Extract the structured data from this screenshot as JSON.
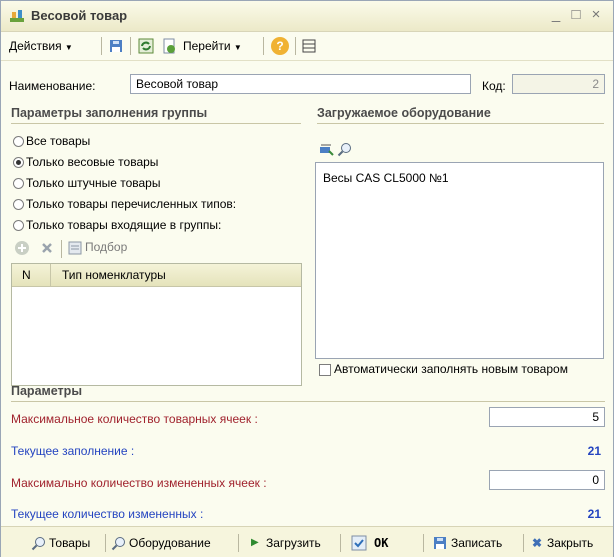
{
  "window": {
    "title": "Весовой товар",
    "minimize_glyph": "_",
    "maximize_glyph": "□",
    "close_glyph": "×"
  },
  "toolbar": {
    "actions_label": "Действия",
    "goto_label": "Перейти",
    "help_glyph": "?"
  },
  "form": {
    "name_label": "Наименование:",
    "name_value": "Весовой товар",
    "code_label": "Код:",
    "code_value": "2"
  },
  "fill_params": {
    "title": "Параметры заполнения группы",
    "options": [
      {
        "label": "Все товары",
        "selected": false
      },
      {
        "label": "Только весовые товары",
        "selected": true
      },
      {
        "label": "Только штучные товары",
        "selected": false
      },
      {
        "label": "Только товары перечисленных типов:",
        "selected": false
      },
      {
        "label": "Только товары входящие в группы:",
        "selected": false
      }
    ],
    "select_label": "Подбор",
    "table": {
      "col_n": "N",
      "col_type": "Тип номенклатуры",
      "rows": []
    }
  },
  "equipment": {
    "title": "Загружаемое оборудование",
    "items": [
      "Весы CAS CL5000 №1"
    ],
    "auto_fill_label": "Автоматически заполнять новым товаром",
    "auto_fill_checked": false
  },
  "params": {
    "title": "Параметры",
    "max_cells_label": "Максимальное количество товарных ячеек :",
    "max_cells_value": "5",
    "current_fill_label": "Текущее заполнение :",
    "current_fill_value": "21",
    "max_changed_label": "Максимально количество измененных ячеек :",
    "max_changed_value": "0",
    "current_changed_label": "Текущее количество измененных :",
    "current_changed_value": "21"
  },
  "bottom": {
    "goods_label": "Товары",
    "equipment_label": "Оборудование",
    "load_label": "Загрузить",
    "ok_label": "OK",
    "save_label": "Записать",
    "close_label": "Закрыть"
  },
  "colors": {
    "accent_red": "#a0222d",
    "accent_blue": "#2444c0",
    "window_bg": "#fbfcef"
  }
}
